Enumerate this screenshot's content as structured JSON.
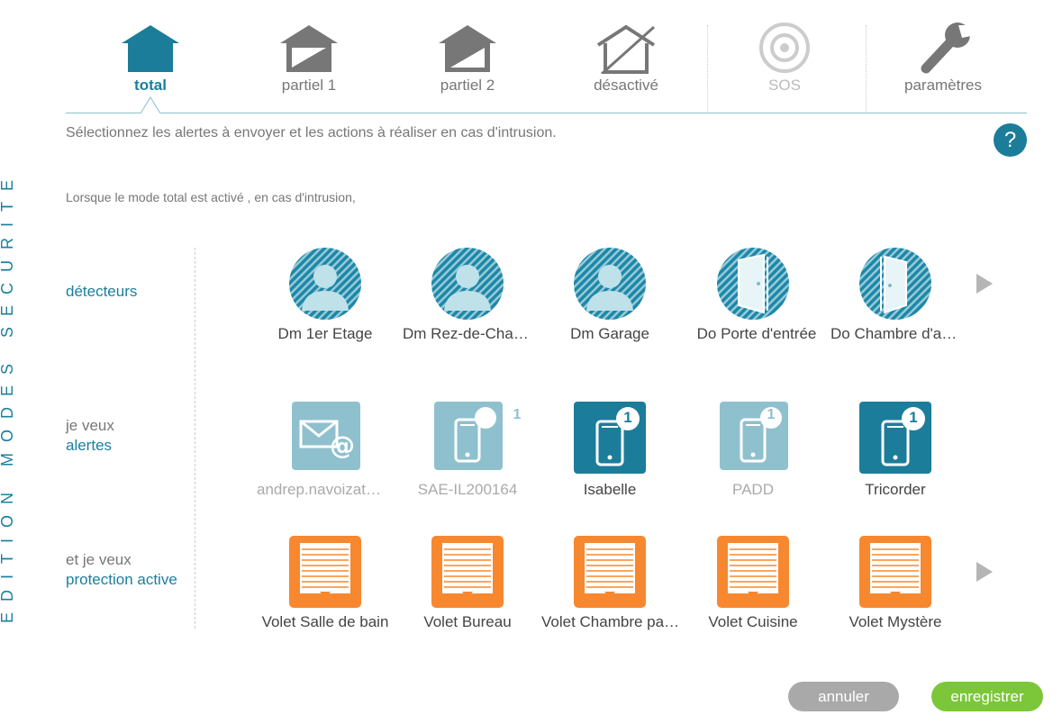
{
  "side_title": "EDITION MODES SECURITE",
  "modes": [
    {
      "label": "total",
      "icon": "house-filled-icon"
    },
    {
      "label": "partiel 1",
      "icon": "house-partial-icon"
    },
    {
      "label": "partiel 2",
      "icon": "house-partial-icon"
    },
    {
      "label": "désactivé",
      "icon": "house-disabled-icon"
    },
    {
      "label": "SOS",
      "icon": "target-icon"
    },
    {
      "label": "paramètres",
      "icon": "wrench-icon"
    }
  ],
  "instruction": "Sélectionnez les alertes à envoyer et les actions à réaliser en cas d'intrusion.",
  "help_label": "?",
  "when_text": "Lorsque le mode total est activé , en cas d'intrusion,",
  "rows": {
    "detecteurs": {
      "line1": "détecteurs",
      "line2": ""
    },
    "alertes": {
      "line1": "je veux",
      "line2": "alertes"
    },
    "protection": {
      "line1": "et je veux",
      "line2": "protection active"
    }
  },
  "detectors": [
    {
      "label": "Dm 1er Etage",
      "icon": "motion-detector-icon"
    },
    {
      "label": "Dm Rez-de-Chaussée",
      "icon": "motion-detector-icon"
    },
    {
      "label": "Dm Garage",
      "icon": "motion-detector-icon"
    },
    {
      "label": "Do Porte d'entrée",
      "icon": "door-opening-icon"
    },
    {
      "label": "Do Chambre d'amis",
      "icon": "door-opening-icon"
    }
  ],
  "alerts": [
    {
      "label": "andrep.navoizat@gmail.com",
      "icon": "email-icon",
      "active": false,
      "badge": ""
    },
    {
      "label": "SAE-IL200164",
      "icon": "phone-icon",
      "active": false,
      "badge": "1"
    },
    {
      "label": "Isabelle",
      "icon": "phone-icon",
      "active": true,
      "badge": "1"
    },
    {
      "label": "PADD",
      "icon": "phone-icon",
      "active": false,
      "badge": "1"
    },
    {
      "label": "Tricorder",
      "icon": "phone-icon",
      "active": true,
      "badge": "1"
    }
  ],
  "shutters": [
    {
      "label": "Volet Salle de bain",
      "icon": "shutter-icon"
    },
    {
      "label": "Volet Bureau",
      "icon": "shutter-icon"
    },
    {
      "label": "Volet Chambre parents",
      "icon": "shutter-icon"
    },
    {
      "label": "Volet Cuisine",
      "icon": "shutter-icon"
    },
    {
      "label": "Volet Mystère",
      "icon": "shutter-icon"
    }
  ],
  "buttons": {
    "cancel": "annuler",
    "save": "enregistrer"
  },
  "colors": {
    "accent": "#1b7d99",
    "inactive_tile": "#8fc0ce",
    "orange": "#f7882f",
    "save": "#7cc63a",
    "cancel": "#a9a9a9"
  }
}
